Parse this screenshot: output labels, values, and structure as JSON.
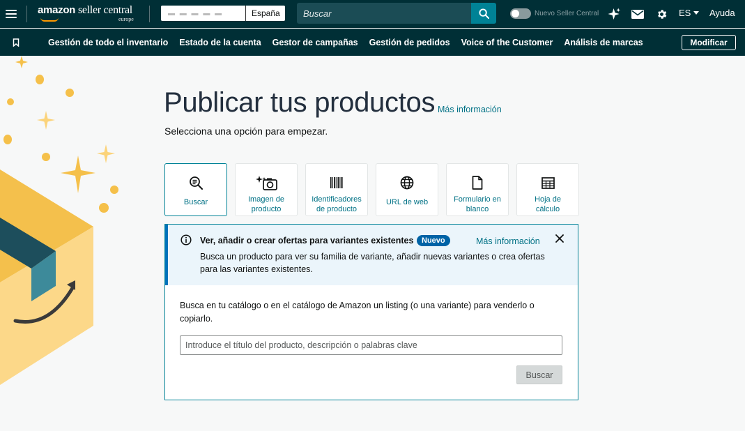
{
  "header": {
    "brand": "amazon",
    "brand_product": "seller central",
    "region": "europe",
    "account_name_blurred": "▬ ▬ ▬ ▬ ▬",
    "marketplace": "España",
    "search_placeholder": "Buscar",
    "toggle_label": "Nuevo Seller Central",
    "language": "ES",
    "help": "Ayuda",
    "icons": [
      "menu-icon",
      "sparkle-icon",
      "mail-icon",
      "gear-icon",
      "search-icon"
    ]
  },
  "nav": {
    "items": [
      {
        "label": "Gestión de todo el inventario"
      },
      {
        "label": "Estado de la cuenta"
      },
      {
        "label": "Gestor de campañas"
      },
      {
        "label": "Gestión de pedidos"
      },
      {
        "label": "Voice of the Customer"
      },
      {
        "label": "Análisis de marcas"
      }
    ],
    "modify_label": "Modificar"
  },
  "main": {
    "title": "Publicar tus productos",
    "more_info": "Más información",
    "subtitle": "Selecciona una opción para empezar.",
    "options": [
      {
        "line1": "Buscar",
        "line2": "",
        "icon": "search-doc-icon",
        "selected": true
      },
      {
        "line1": "Imagen de",
        "line2": "producto",
        "icon": "camera-sparkle-icon",
        "selected": false
      },
      {
        "line1": "Identificadores",
        "line2": "de producto",
        "icon": "barcode-icon",
        "selected": false
      },
      {
        "line1": "URL de web",
        "line2": "",
        "icon": "globe-icon",
        "selected": false
      },
      {
        "line1": "Formulario en",
        "line2": "blanco",
        "icon": "document-icon",
        "selected": false
      },
      {
        "line1": "Hoja de",
        "line2": "cálculo",
        "icon": "spreadsheet-icon",
        "selected": false
      }
    ]
  },
  "alert": {
    "title": "Ver, añadir o crear ofertas para variantes existentes",
    "badge": "Nuevo",
    "more_info": "Más información",
    "body": "Busca un producto para ver su familia de variante, añadir nuevas variantes o crea ofertas para las variantes existentes."
  },
  "search_panel": {
    "description": "Busca en tu catálogo o en el catálogo de Amazon un listing (o una variante) para venderlo o copiarlo.",
    "input_placeholder": "Introduce el título del producto, descripción o palabras clave",
    "input_value": "",
    "button_label": "Buscar"
  },
  "colors": {
    "header_bg": "#002f36",
    "accent_teal": "#008296",
    "link": "#007185",
    "alert_bg": "#ebf5fb",
    "badge": "#0063a6",
    "deco_yellow": "#f5c04a",
    "deco_dark": "#1d4e5c"
  }
}
